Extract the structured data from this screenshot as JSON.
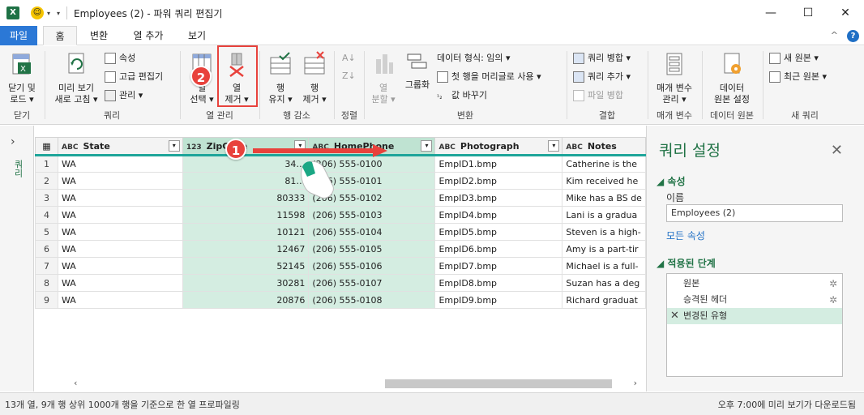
{
  "window": {
    "title": "Employees (2) - 파워 쿼리 편집기",
    "minimize": "—",
    "maximize": "☐",
    "close": "✕"
  },
  "quick_access": {
    "logo": "X"
  },
  "tabs": {
    "file": "파일",
    "home": "홈",
    "transform": "변환",
    "add_column": "열 추가",
    "view": "보기",
    "collapse": "^",
    "help": "?"
  },
  "ribbon": {
    "close_group": {
      "close_load_1": "닫기 및",
      "close_load_2": "로드 ▾",
      "label": "닫기"
    },
    "query_group": {
      "refresh_1": "미리 보기",
      "refresh_2": "새로 고침 ▾",
      "properties": "속성",
      "advanced_editor": "고급 편집기",
      "manage": "관리 ▾",
      "label": "쿼리"
    },
    "manage_columns_group": {
      "choose_1": "열",
      "choose_2": "선택 ▾",
      "remove_1": "열",
      "remove_2": "제거 ▾",
      "label": "열 관리"
    },
    "reduce_rows_group": {
      "keep_1": "행",
      "keep_2": "유지 ▾",
      "remove_1": "행",
      "remove_2": "제거 ▾",
      "label": "행 감소"
    },
    "sort_group": {
      "label": "정렬"
    },
    "transform_group": {
      "split_1": "열",
      "split_2": "분할 ▾",
      "group_by": "그룹화",
      "data_type": "데이터 형식: 임의 ▾",
      "first_row_header": "첫 행을 머리글로 사용 ▾",
      "replace_values": "값 바꾸기",
      "label": "변환"
    },
    "combine_group": {
      "merge": "쿼리 병합 ▾",
      "append": "쿼리 추가 ▾",
      "combine_files": "파일 병합",
      "label": "결합"
    },
    "params_group": {
      "manage_1": "매개 변수",
      "manage_2": "관리 ▾",
      "label": "매개 변수"
    },
    "datasource_group": {
      "settings_1": "데이터",
      "settings_2": "원본 설정",
      "label": "데이터 원본"
    },
    "newquery_group": {
      "new_source": "새 원본 ▾",
      "recent_source": "최근 원본 ▾",
      "label": "새 쿼리"
    }
  },
  "annotations": {
    "badge_1": "1",
    "badge_2": "2"
  },
  "left_pane": {
    "chevron": "›",
    "label": "쿼리"
  },
  "grid": {
    "columns": [
      {
        "type": "ABC",
        "name": "State"
      },
      {
        "type": "123",
        "name": "ZipCode"
      },
      {
        "type": "ABC",
        "name": "HomePhone"
      },
      {
        "type": "ABC",
        "name": "Photograph"
      },
      {
        "type": "ABC",
        "name": "Notes"
      }
    ],
    "rows": [
      {
        "n": "1",
        "state": "WA",
        "zip": "34…",
        "phone": "(206) 555-0100",
        "photo": "EmpID1.bmp",
        "notes": "Catherine is the"
      },
      {
        "n": "2",
        "state": "WA",
        "zip": "81…",
        "phone": "(206) 555-0101",
        "photo": "EmpID2.bmp",
        "notes": "Kim received he"
      },
      {
        "n": "3",
        "state": "WA",
        "zip": "80333",
        "phone": "(206) 555-0102",
        "photo": "EmpID3.bmp",
        "notes": "Mike has a BS de"
      },
      {
        "n": "4",
        "state": "WA",
        "zip": "11598",
        "phone": "(206) 555-0103",
        "photo": "EmpID4.bmp",
        "notes": "Lani  is a gradua"
      },
      {
        "n": "5",
        "state": "WA",
        "zip": "10121",
        "phone": "(206) 555-0104",
        "photo": "EmpID5.bmp",
        "notes": "Steven is a high-"
      },
      {
        "n": "6",
        "state": "WA",
        "zip": "12467",
        "phone": "(206) 555-0105",
        "photo": "EmpID6.bmp",
        "notes": "Amy is a part-tir"
      },
      {
        "n": "7",
        "state": "WA",
        "zip": "52145",
        "phone": "(206) 555-0106",
        "photo": "EmpID7.bmp",
        "notes": "Michael is a full-"
      },
      {
        "n": "8",
        "state": "WA",
        "zip": "30281",
        "phone": "(206) 555-0107",
        "photo": "EmpID8.bmp",
        "notes": "Suzan has a deg"
      },
      {
        "n": "9",
        "state": "WA",
        "zip": "20876",
        "phone": "(206) 555-0108",
        "photo": "EmpID9.bmp",
        "notes": "Richard graduat"
      }
    ]
  },
  "query_settings": {
    "title": "쿼리 설정",
    "close": "✕",
    "properties_header": "◢ 속성",
    "name_label": "이름",
    "name_value": "Employees (2)",
    "all_properties": "모든 속성",
    "applied_steps_header": "◢ 적용된 단계",
    "steps": [
      "원본",
      "승격된 헤더",
      "변경된 유형"
    ]
  },
  "status": {
    "left": "13개 열, 9개 행    상위 1000개 행을 기준으로 한 열 프로파일링",
    "right": "오후 7:00에 미리 보기가 다운로드됨"
  },
  "colors": {
    "accent": "#217346",
    "highlight": "#e8423c",
    "selection": "#d4ede1",
    "file_tab": "#2b78d6"
  }
}
